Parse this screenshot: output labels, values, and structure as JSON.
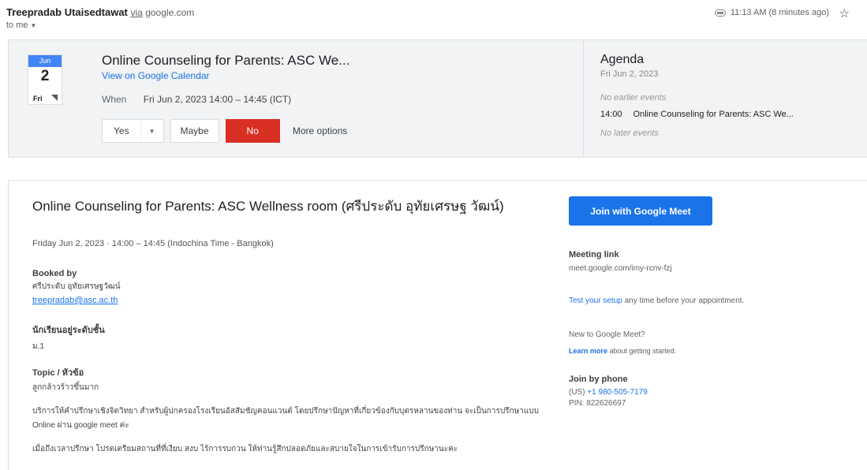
{
  "header": {
    "sender_name": "Treepradab Utaisedtawat",
    "via_label": "via",
    "via_domain": "google.com",
    "to_me": "to me",
    "timestamp": "11:13 AM (8 minutes ago)"
  },
  "invite": {
    "cal_month": "Jun",
    "cal_day": "2",
    "cal_dow": "Fri",
    "title": "Online Counseling for Parents: ASC We...",
    "calendar_link": "View on Google Calendar",
    "when_label": "When",
    "when_value": "Fri Jun 2, 2023 14:00 – 14:45 (ICT)",
    "rsvp": {
      "yes": "Yes",
      "maybe": "Maybe",
      "no": "No",
      "more": "More options"
    }
  },
  "agenda": {
    "heading": "Agenda",
    "date": "Fri Jun 2, 2023",
    "no_earlier": "No earlier events",
    "event_time": "14:00",
    "event_title": "Online Counseling for Parents: ASC We...",
    "no_later": "No later events"
  },
  "details": {
    "title": "Online Counseling for Parents: ASC Wellness room (ศรีประดับ อุทัยเศรษฐ วัฒน์)",
    "when": "Friday Jun 2, 2023 · 14:00 – 14:45 (Indochina Time - Bangkok)",
    "booked_by_label": "Booked by",
    "booked_by_name": "ศรีประดับ อุทัยเศรษฐวัฒน์",
    "booked_by_email": "treepradab@asc.ac.th",
    "grade_label": "นักเรียนอยู่ระดับชั้น",
    "grade_value": "ม.1",
    "topic_label": "Topic / หัวข้อ",
    "topic_value": "ลูกกล้าวร้าวขึ้นมาก",
    "para1": "บริการให้คำปรึกษาเชิงจิตวิทยา สำหรับผู้ปกครองโรงเรียนอัสสัมชัญคอนแวนต์ โดยปรึกษาปัญหาที่เกี่ยวข้องกับบุตรหลานของท่าน จะเป็นการปรึกษาแบบ Online ผ่าน google meet ค่ะ",
    "para2": "เมื่อถึงเวลาปรึกษา โปรดเตรียมสถานที่ที่เงียบ สงบ ไร้การรบกวน ให้ท่านรู้สึกปลอดภัยและสบายใจในการเข้ารับการปรึกษานะคะ"
  },
  "meet": {
    "join_button": "Join with Google Meet",
    "link_label": "Meeting link",
    "link_value": "meet.google.com/imy-rcnv-fzj",
    "test_link": "Test your setup",
    "test_rest": " any time before your appointment.",
    "new_q": "New to Google Meet?",
    "learn_more": "Learn more",
    "learn_rest": " about getting started.",
    "phone_label": "Join by phone",
    "phone_country": "(US)",
    "phone_number": "+1 980-505-7179",
    "pin": "PIN: 822626697"
  },
  "colors": {
    "accent": "#1a73e8",
    "decline": "#d93025",
    "calendar_header": "#4285f4"
  },
  "icons": [
    "chevron-down-icon",
    "tag-icon",
    "star-icon",
    "dropdown-icon"
  ]
}
